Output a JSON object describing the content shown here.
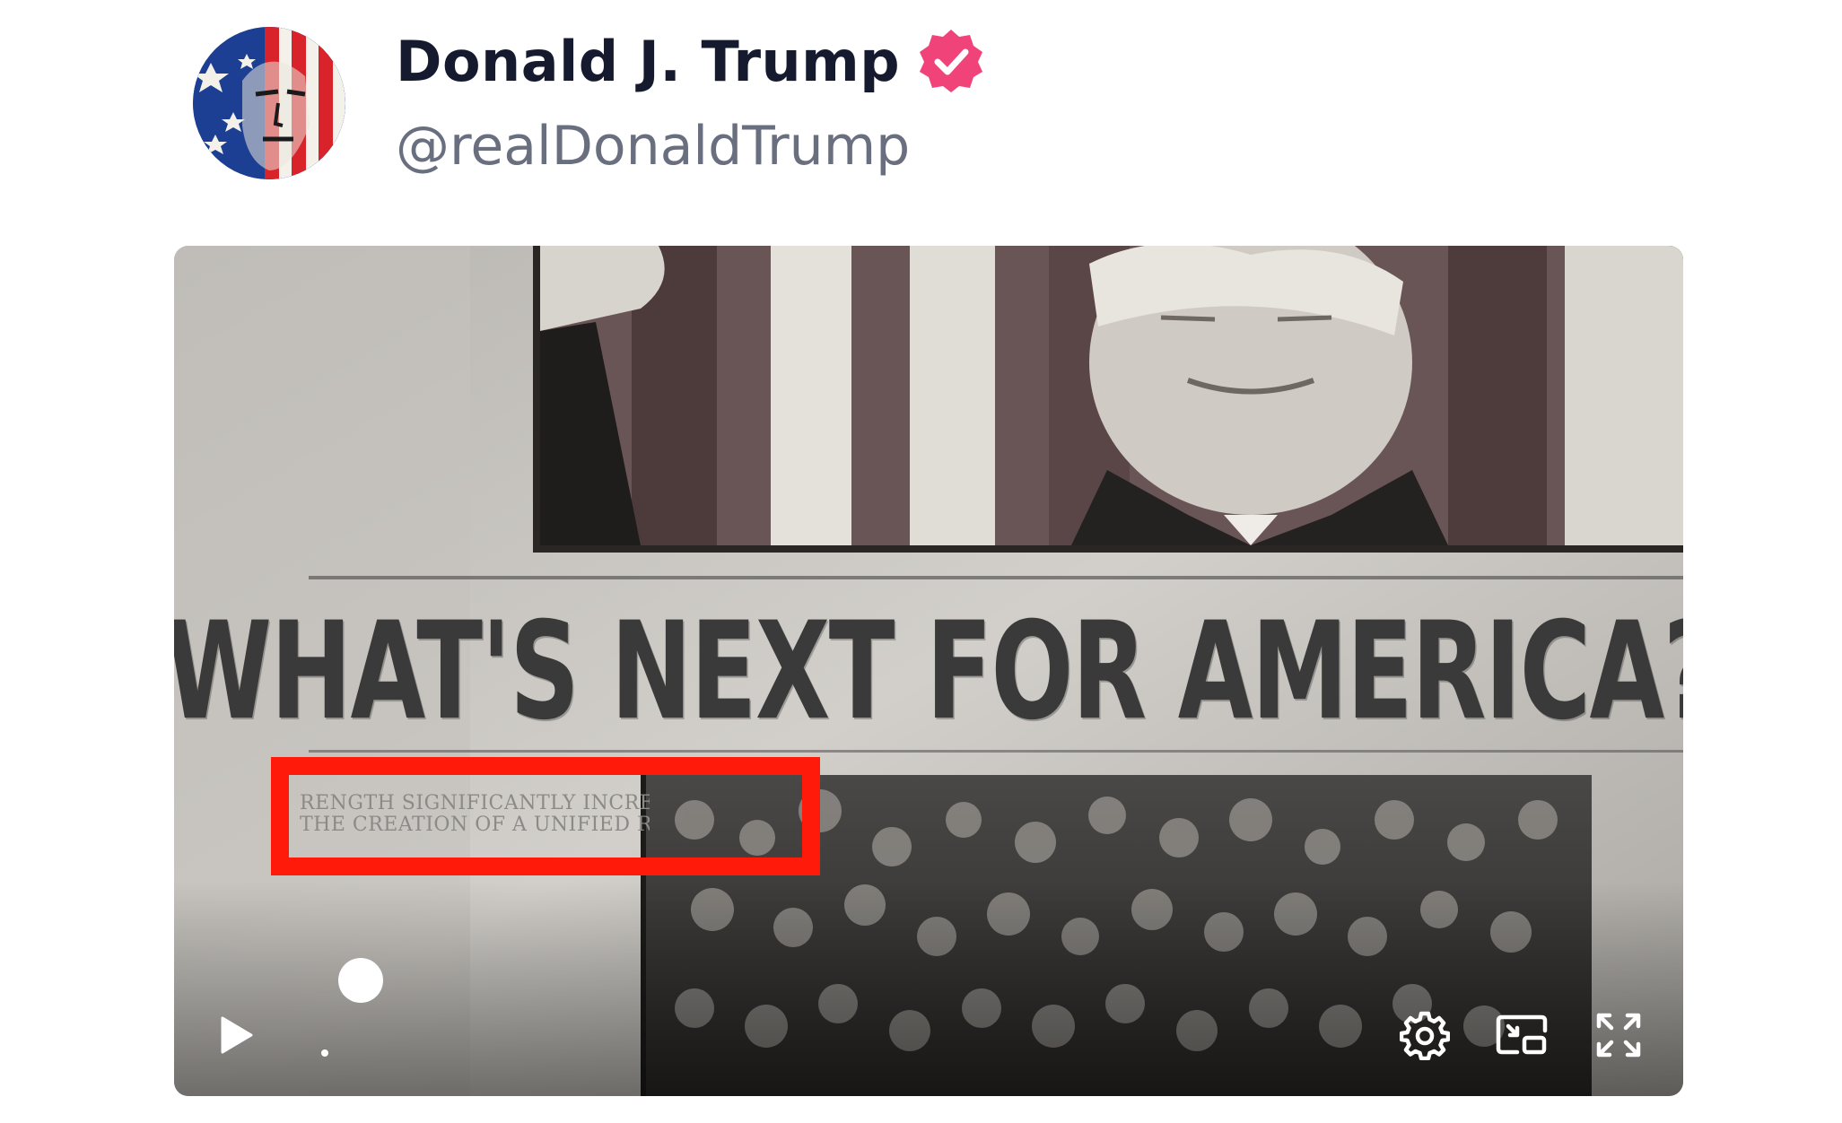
{
  "post": {
    "display_name": "Donald J. Trump",
    "handle": "@realDonaldTrump",
    "verified": true
  },
  "video": {
    "headline": "WHAT'S NEXT FOR AMERICA?",
    "clipping_lines": [
      "RENGTH SIGNIFICANTLY INCREASED",
      "THE CREATION OF A UNIFIED REICH"
    ],
    "highlight_color": "#ff1a0a",
    "progress": 0.11,
    "controls": {
      "play_icon": "play-icon",
      "settings_icon": "gear-icon",
      "pip_icon": "picture-in-picture-icon",
      "fullscreen_icon": "fullscreen-icon"
    }
  },
  "colors": {
    "verified_badge": "#f0437a",
    "display_name": "#161a2e",
    "handle": "#6a6f80"
  }
}
